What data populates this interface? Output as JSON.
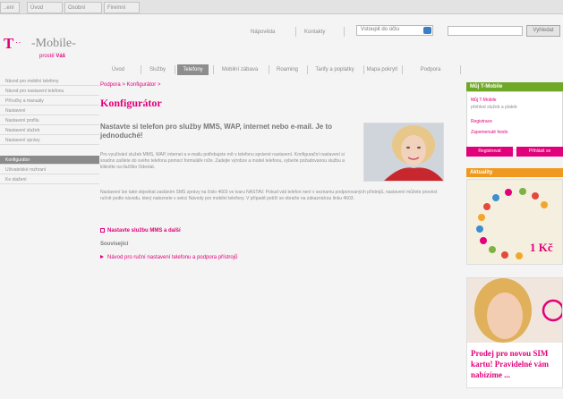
{
  "browser": {
    "tabs": [
      "..ení",
      "Úvod",
      "Osobní",
      "Firemní"
    ]
  },
  "header": {
    "logo_brand": "-Mobile-",
    "logo_t": "T",
    "logo_dots": "· ·",
    "logo_sub_prefix": "prostě ",
    "logo_sub_highlight": "Váš",
    "utility_links": [
      "Nápověda",
      "Kontakty"
    ],
    "login_select_value": "Vstoupit do účtu",
    "search_button_label": "Vyhledat"
  },
  "main_nav": {
    "items": [
      "Úvod",
      "Služby",
      "Telefony",
      "Mobilní zábava",
      "Roaming",
      "Tarify a poplatky",
      "Mapa pokrytí",
      "Podpora"
    ],
    "active_index": 2
  },
  "sidebar": {
    "items": [
      "Návod pro mobilní telefony",
      "Návod pro nastavení telefonu",
      "Příručky a manuály",
      "Nastavení",
      "Nastavení profilu",
      "Nastavení služeb",
      "Nastavení zprávy",
      "Konfigurátor",
      "Uživatelské rozhraní",
      "Ke stažení"
    ],
    "active_index": 7
  },
  "content": {
    "breadcrumb": "Podpora > Konfigurátor >",
    "title": "Konfigurátor",
    "lead": "Nastavte si telefon pro služby MMS, WAP, internet nebo e-mail. Je to jednoduché!",
    "body1": "Pro využívání služeb MMS, WAP, internet a e-mailu potřebujete mít v telefonu správné nastavení. Konfigurační nastavení si snadno zašlete do svého telefonu pomocí formuláře níže. Zadejte výrobce a model telefonu, vyberte požadovanou službu a klikněte na tlačítko Odeslat.",
    "body2": "Nastavení lze také objednat zasláním SMS zprávy na číslo 4603 ve tvaru NASTAV. Pokud váš telefon není v seznamu podporovaných přístrojů, nastavení můžete provést ručně podle návodu, který naleznete v sekci Návody pro mobilní telefony. V případě potíží se obraťte na zákaznickou linku 4603.",
    "settings_link": "Nastavte službu MMS a další",
    "related_heading": "Související",
    "related_link": "Návod pro ruční nastavení telefonu a podpora přístrojů"
  },
  "right": {
    "panel1_title": "Můj T-Mobile",
    "panel1_link1": "Můj T-Mobile",
    "panel1_text": "přehled služeb a plateb",
    "panel1_link2": "Registrace",
    "panel1_link3": "Zapomenuté heslo",
    "panel1_btn1": "Registrovat",
    "panel1_btn2": "Přihlásit se",
    "panel2_title": "Aktuality",
    "promo1_price": "1 Kč",
    "promo2_text": "Prodej pro novou SIM kartu! Pravidelné vám nabízíme ..."
  },
  "colors": {
    "brand": "#e2007a",
    "nav_active": "#8d8d8d",
    "panel_green": "#6fa827",
    "panel_orange": "#ef9a1e"
  }
}
